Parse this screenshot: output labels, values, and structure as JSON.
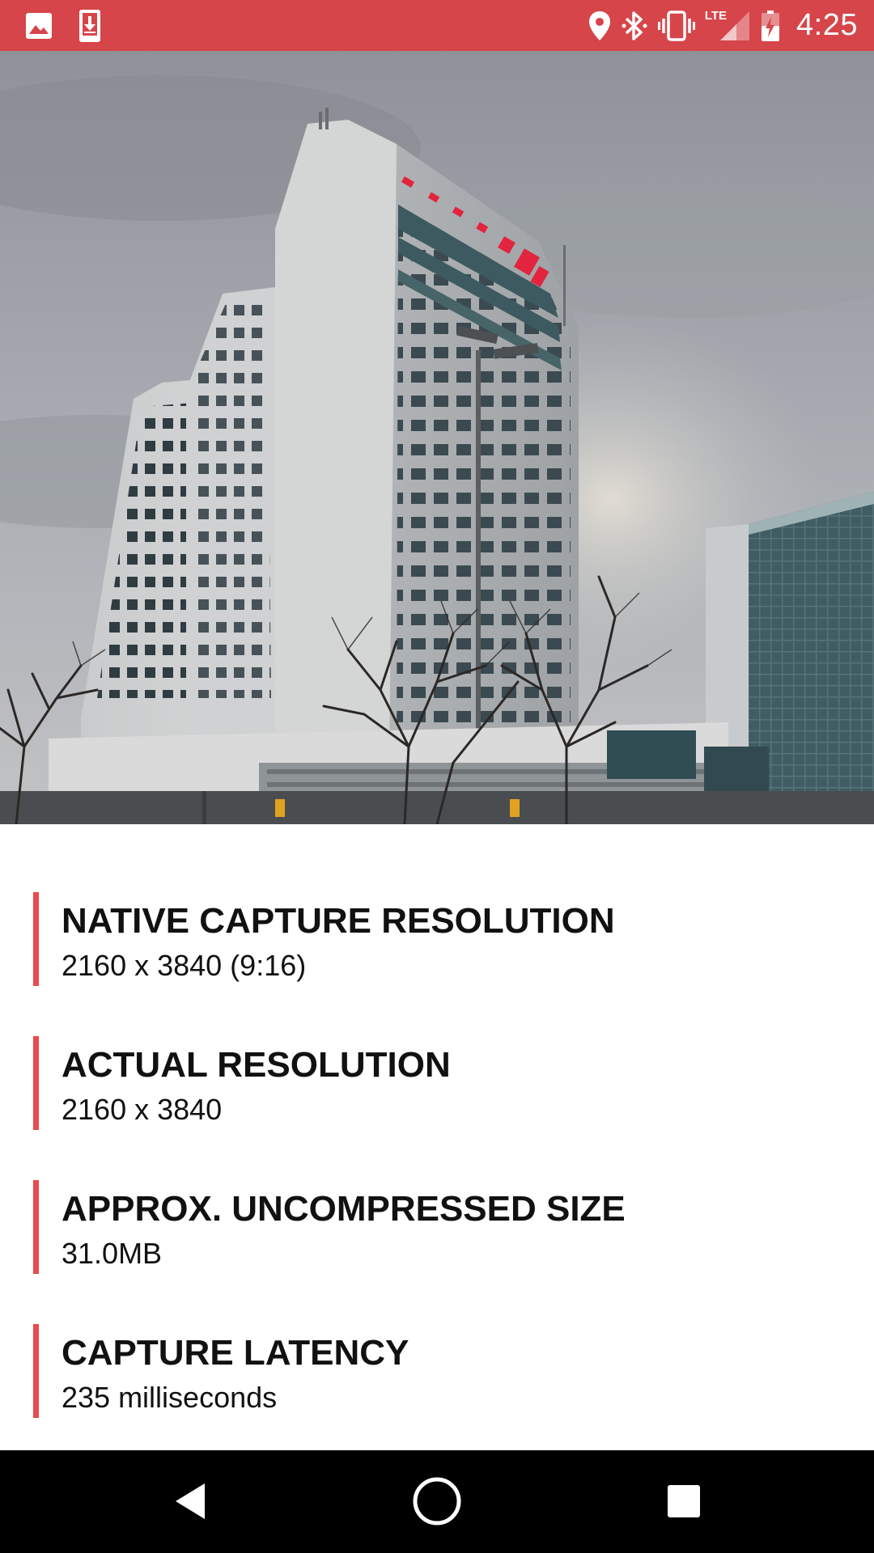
{
  "status_bar": {
    "time": "4:25",
    "network": "LTE",
    "background_color": "#d6454a",
    "left_icons": [
      "image-notification-icon",
      "download-notification-icon"
    ],
    "right_icons": [
      "location-icon",
      "bluetooth-icon",
      "vibrate-icon",
      "cell-signal-icon",
      "battery-charging-icon"
    ]
  },
  "photo": {
    "description_icon": "captured-photo"
  },
  "info": {
    "accent_color": "#ea4b4b",
    "items": [
      {
        "title": "NATIVE CAPTURE RESOLUTION",
        "value": "2160 x 3840 (9:16)"
      },
      {
        "title": "ACTUAL RESOLUTION",
        "value": "2160 x 3840"
      },
      {
        "title": "APPROX. UNCOMPRESSED SIZE",
        "value": "31.0MB"
      },
      {
        "title": "CAPTURE LATENCY",
        "value": "235 milliseconds"
      }
    ]
  },
  "nav_bar": {
    "buttons": [
      "back-icon",
      "home-icon",
      "recents-icon"
    ]
  }
}
